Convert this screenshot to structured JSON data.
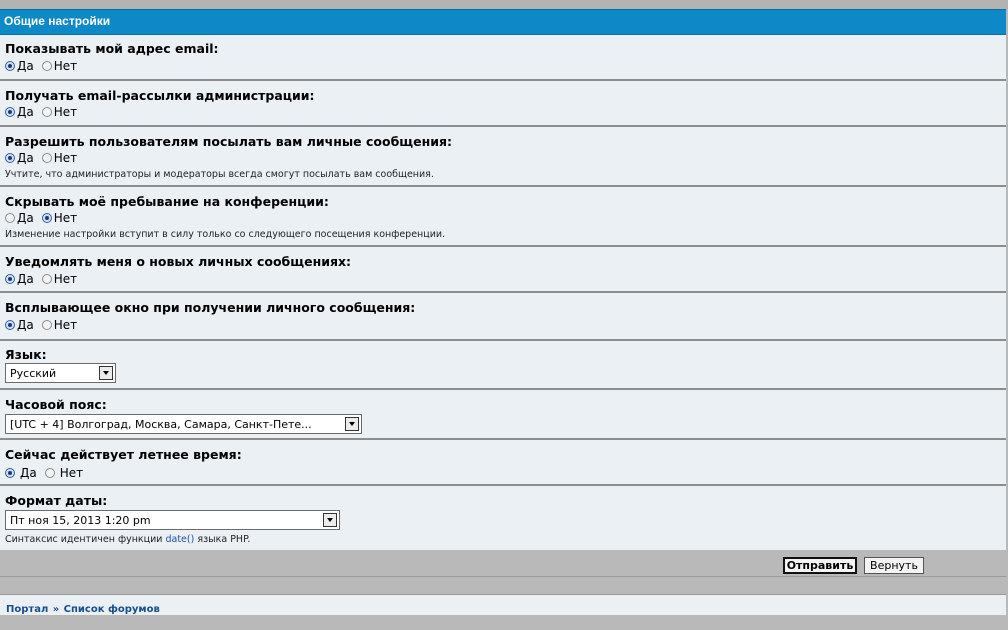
{
  "header": {
    "title": "Общие настройки"
  },
  "options": {
    "yes": "Да",
    "no": "Нет"
  },
  "settings": {
    "show_email": {
      "label": "Показывать мой адрес email:",
      "selected": "yes"
    },
    "admin_email": {
      "label": "Получать email-рассылки администрации:",
      "selected": "yes"
    },
    "allow_pm": {
      "label": "Разрешить пользователям посылать вам личные сообщения:",
      "selected": "yes",
      "note": "Учтите, что администраторы и модераторы всегда смогут посылать вам сообщения."
    },
    "hide_online": {
      "label": "Скрывать моё пребывание на конференции:",
      "selected": "no",
      "note": "Изменение настройки вступит в силу только со следующего посещения конференции."
    },
    "notify_pm": {
      "label": "Уведомлять меня о новых личных сообщениях:",
      "selected": "yes"
    },
    "popup_pm": {
      "label": "Всплывающее окно при получении личного сообщения:",
      "selected": "yes"
    },
    "language": {
      "label": "Язык:",
      "value": "Русский"
    },
    "timezone": {
      "label": "Часовой пояс:",
      "value": "[UTC + 4] Волгоград, Москва, Самара, Санкт-Пете..."
    },
    "dst": {
      "label": "Сейчас действует летнее время:",
      "selected": "yes"
    },
    "date_format": {
      "label": "Формат даты:",
      "value": "Пт ноя 15, 2013 1:20 pm",
      "note_prefix": "Синтаксис идентичен функции ",
      "note_link": "date()",
      "note_suffix": " языка PHP."
    }
  },
  "buttons": {
    "submit": "Отправить",
    "reset": "Вернуть"
  },
  "breadcrumb": {
    "portal": "Портал",
    "separator": "»",
    "forums": "Список форумов"
  }
}
